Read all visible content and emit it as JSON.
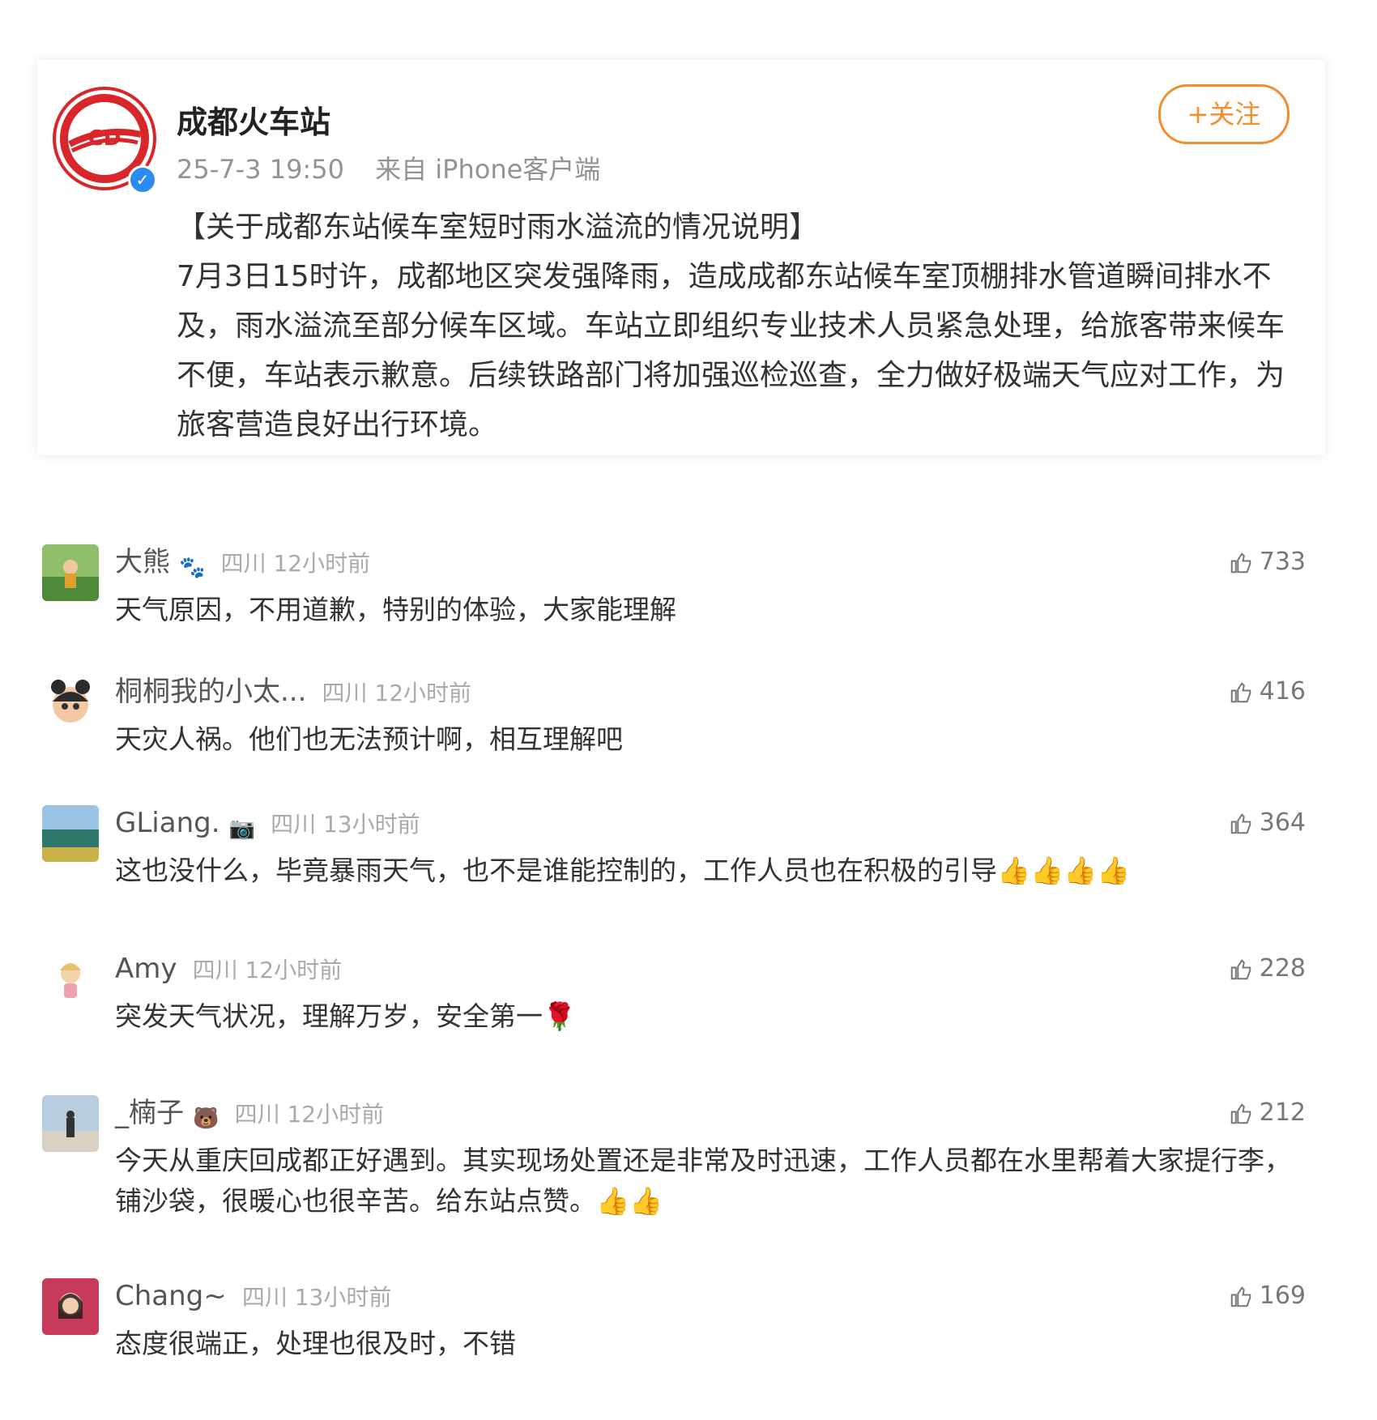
{
  "post": {
    "author": "成都火车站",
    "time": "25-7-3 19:50",
    "source": "来自 iPhone客户端",
    "follow_label": "+关注",
    "title": "【关于成都东站候车室短时雨水溢流的情况说明】",
    "body": "7月3日15时许，成都地区突发强降雨，造成成都东站候车室顶棚排水管道瞬间排水不及，雨水溢流至部分候车区域。车站立即组织专业技术人员紧急处理，给旅客带来候车不便，车站表示歉意。后续铁路部门将加强巡检巡查，全力做好极端天气应对工作，为旅客营造良好出行环境。",
    "logo_text": "CD",
    "colors": {
      "accent": "#f28e2b",
      "verified": "#2a8cf0",
      "logo_red": "#d8262b"
    }
  },
  "comments": [
    {
      "name": "大熊",
      "badge": "paw-icon",
      "location": "四川 12小时前",
      "text": "天气原因，不用道歉，特别的体验，大家能理解",
      "likes": "733"
    },
    {
      "name": "桐桐我的小太...",
      "badge": "",
      "location": "四川 12小时前",
      "text": "天灾人祸。他们也无法预计啊，相互理解吧",
      "likes": "416"
    },
    {
      "name": "GLiang.",
      "badge": "camera-icon",
      "location": "四川 13小时前",
      "text": "这也没什么，毕竟暴雨天气，也不是谁能控制的，工作人员也在积极的引导👍👍👍👍",
      "likes": "364"
    },
    {
      "name": "Amy",
      "badge": "",
      "location": "四川 12小时前",
      "text": "突发天气状况，理解万岁，安全第一🌹",
      "likes": "228"
    },
    {
      "name": "_楠子",
      "badge": "bear-icon",
      "location": "四川 12小时前",
      "text": "今天从重庆回成都正好遇到。其实现场处置还是非常及时迅速，工作人员都在水里帮着大家提行李，铺沙袋，很暖心也很辛苦。给东站点赞。👍👍",
      "likes": "212"
    },
    {
      "name": "Chang~",
      "badge": "",
      "location": "四川 13小时前",
      "text": "态度很端正，处理也很及时，不错",
      "likes": "169"
    }
  ]
}
